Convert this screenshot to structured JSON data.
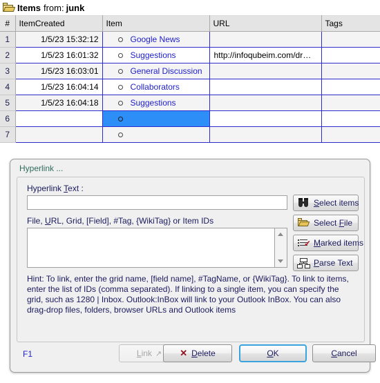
{
  "window": {
    "folder_icon": "folder-open-icon",
    "title_prefix": "Items",
    "title_from": "from:",
    "title_source": "junk"
  },
  "grid": {
    "columns": [
      "#",
      "ItemCreated",
      "Item",
      "URL",
      "Tags"
    ],
    "selection_color": "#2e8ef7",
    "link_color": "#2020cf",
    "rows": [
      {
        "num": "1",
        "created": "1/5/23 15:32:12",
        "item": "Google News",
        "url": "",
        "tags": "",
        "selected": false
      },
      {
        "num": "2",
        "created": "1/5/23 16:01:32",
        "item": "Suggestions",
        "url": "http://infoqubeim.com/dr…",
        "tags": "",
        "selected": false
      },
      {
        "num": "3",
        "created": "1/5/23 16:03:01",
        "item": "General Discussion",
        "url": "",
        "tags": "",
        "selected": false
      },
      {
        "num": "4",
        "created": "1/5/23 16:04:14",
        "item": "Collaborators",
        "url": "",
        "tags": "",
        "selected": false
      },
      {
        "num": "5",
        "created": "1/5/23 16:04:18",
        "item": "Suggestions",
        "url": "",
        "tags": "",
        "selected": false
      },
      {
        "num": "6",
        "created": "",
        "item": "",
        "url": "",
        "tags": "",
        "selected": true
      },
      {
        "num": "7",
        "created": "",
        "item": "",
        "url": "",
        "tags": "",
        "selected": false
      }
    ]
  },
  "dialog": {
    "title": "Hyperlink ...",
    "title_color": "#2f6b5c",
    "hyperlink_text": {
      "label": "Hyperlink ",
      "label_accel": "T",
      "label_rest": "ext :",
      "value": "",
      "placeholder": ""
    },
    "ids_field": {
      "label_a": "File, ",
      "label_accel": "U",
      "label_b": "RL, Grid, [Field], #Tag, {WikiTag} or Item IDs",
      "value": "",
      "placeholder": ""
    },
    "side_buttons": [
      {
        "icon": "binoculars-icon",
        "accel": "S",
        "label_rest": "elect items",
        "name": "select-items"
      },
      {
        "icon": "folder-open-icon",
        "pre": "Select ",
        "accel": "F",
        "label_rest": "ile",
        "name": "select-file"
      },
      {
        "icon": "marked-list-icon",
        "accel": "M",
        "label_rest": "arked items",
        "name": "marked-items"
      },
      {
        "icon": "hierarchy-icon",
        "accel": "P",
        "label_rest": "arse Text",
        "name": "parse-text"
      }
    ],
    "hint": "Hint: To link, enter the grid name, [field name], #TagName, or {WikiTag}. To link to items, enter the list of IDs (comma separated). If linking to a single item, you can specify the grid, such as 1280 | Inbox. Outlook:InBox will link to your Outlook InBox. You can also drag-drop files, folders, browser URLs and Outlook items",
    "footer": {
      "f1": "F1",
      "link_accel": "L",
      "link_rest": "ink",
      "link_arrow": "↗",
      "link_enabled": false,
      "delete_accel": "D",
      "delete_rest": "elete",
      "delete_x": "✕",
      "ok_accel": "O",
      "ok_rest": "K",
      "cancel_accel": "C",
      "cancel_rest": "ancel"
    }
  }
}
